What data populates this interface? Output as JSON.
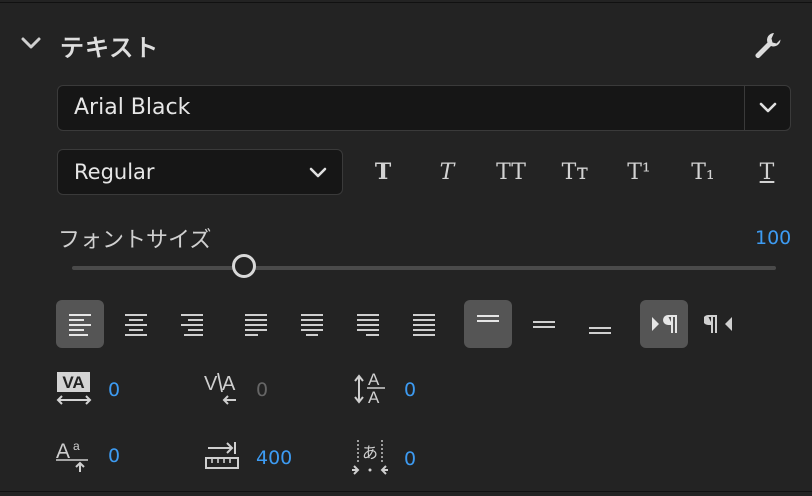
{
  "panel": {
    "title": "テキスト"
  },
  "font_family": {
    "value": "Arial Black"
  },
  "font_style": {
    "value": "Regular"
  },
  "type_styles": [
    {
      "name": "faux-bold",
      "glyph": "T"
    },
    {
      "name": "faux-italic",
      "glyph": "T"
    },
    {
      "name": "all-caps",
      "glyph": "TT"
    },
    {
      "name": "small-caps",
      "glyph": "Tᴛ"
    },
    {
      "name": "superscript",
      "glyph": "T¹"
    },
    {
      "name": "subscript",
      "glyph": "T₁"
    },
    {
      "name": "underline",
      "glyph": "T"
    }
  ],
  "font_size": {
    "label": "フォントサイズ",
    "value": "100",
    "slider_fraction": 0.245
  },
  "metrics": {
    "tracking": "0",
    "kerning": "0",
    "leading": "0",
    "baseline_shift": "0",
    "tab_width": "400",
    "tsume": "0"
  },
  "colors": {
    "accent": "#3d9bf2",
    "background": "#232323",
    "field": "#161616",
    "active_button": "#555555"
  }
}
